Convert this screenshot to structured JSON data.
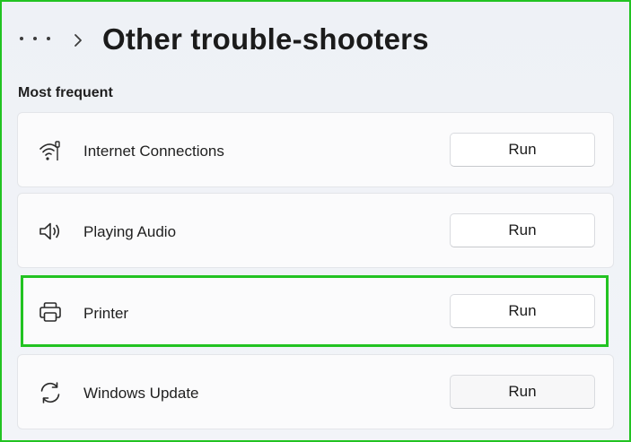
{
  "header": {
    "more_icon": "more-horizontal-icon",
    "chevron_icon": "chevron-right-icon",
    "title": "Other trouble-shooters"
  },
  "section": {
    "label": "Most frequent"
  },
  "troubleshooters": [
    {
      "label": "Internet Connections",
      "icon": "wifi-icon",
      "button": "Run"
    },
    {
      "label": "Playing Audio",
      "icon": "speaker-icon",
      "button": "Run"
    },
    {
      "label": "Printer",
      "icon": "printer-icon",
      "button": "Run",
      "highlighted": true
    },
    {
      "label": "Windows Update",
      "icon": "sync-icon",
      "button": "Run"
    }
  ],
  "colors": {
    "highlight": "#22c322",
    "background": "#eef1f6",
    "card": "#fbfbfc",
    "text": "#1b1b1b"
  }
}
